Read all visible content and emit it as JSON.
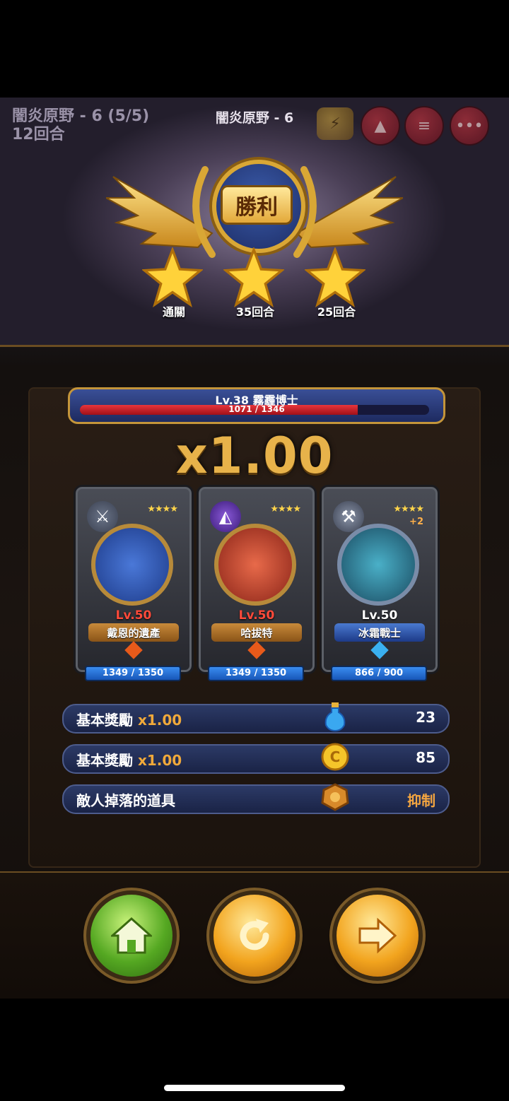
{
  "stage": {
    "top_left_title": "闇炎原野 - 6 (5/5)",
    "top_left_turns": "12回合",
    "center_title": "闇炎原野 - 6"
  },
  "victory": {
    "label": "勝利",
    "stars": [
      {
        "label": "通關"
      },
      {
        "label": "35回合"
      },
      {
        "label": "25回合"
      }
    ]
  },
  "boss": {
    "name": "Lv.38  霧霾博士",
    "hp_text": "1071 / 1346",
    "hp_fraction": 0.796
  },
  "multiplier": "x1.00",
  "heroes": [
    {
      "level": "Lv.50",
      "name": "戴恩的遺產",
      "stars": "★★★★",
      "plus": "",
      "hp": "1349 / 1350",
      "type_icon": "sword-icon",
      "level_color": "#ff4a3a",
      "frame_color": "#b07a28"
    },
    {
      "level": "Lv.50",
      "name": "哈拔特",
      "stars": "★★★★",
      "plus": "",
      "hp": "1349 / 1350",
      "type_icon": "wizard-hat-icon",
      "level_color": "#ff4a3a",
      "frame_color": "#b07a28"
    },
    {
      "level": "Lv.50",
      "name": "冰霜戰士",
      "stars": "★★★★",
      "plus": "+2",
      "hp": "866 / 900",
      "type_icon": "axe-icon",
      "level_color": "#ffffff",
      "frame_color": "#3a6ab0"
    }
  ],
  "rewards": [
    {
      "label": "基本獎勵",
      "mult": "x1.00",
      "value": "23",
      "icon": "potion-icon"
    },
    {
      "label": "基本獎勵",
      "mult": "x1.00",
      "value": "85",
      "icon": "gold-coin-icon"
    },
    {
      "label": "敵人掉落的道具",
      "mult": "",
      "value": "抑制",
      "icon": "drop-medal-icon"
    }
  ],
  "buttons": {
    "home": "home-icon",
    "retry": "retry-icon",
    "next": "next-arrow-icon"
  },
  "colors": {
    "gold": "#e7b24a",
    "reward_mult": "#f0a93a",
    "boss_hp": "#e8353c"
  }
}
